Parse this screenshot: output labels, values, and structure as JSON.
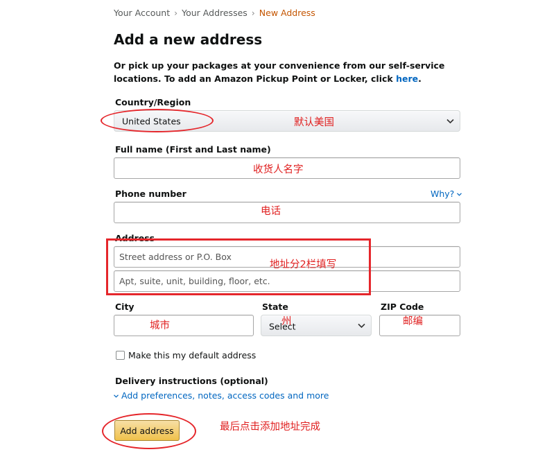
{
  "breadcrumb": {
    "items": [
      "Your Account",
      "Your Addresses"
    ],
    "current": "New Address",
    "separator": "›"
  },
  "page_title": "Add a new address",
  "intro": {
    "text": "Or pick up your packages at your convenience from our self-service locations. To add an Amazon Pickup Point or Locker, click",
    "link": "here",
    "end": "."
  },
  "country": {
    "label": "Country/Region",
    "value": "United States"
  },
  "full_name": {
    "label": "Full name (First and Last name)",
    "value": ""
  },
  "phone": {
    "label": "Phone number",
    "help": "Why?",
    "value": ""
  },
  "address": {
    "label": "Address",
    "line1_placeholder": "Street address or P.O. Box",
    "line2_placeholder": "Apt, suite, unit, building, floor, etc."
  },
  "city": {
    "label": "City",
    "value": ""
  },
  "state": {
    "label": "State",
    "value": "Select"
  },
  "zip": {
    "label": "ZIP Code",
    "value": ""
  },
  "default_checkbox": {
    "label": "Make this my default address",
    "checked": false
  },
  "delivery": {
    "label": "Delivery instructions (optional)",
    "link": "Add preferences, notes, access codes and more"
  },
  "submit": {
    "label": "Add address"
  },
  "annotations": {
    "country_note": "默认美国",
    "name_note": "收货人名字",
    "phone_note": "电话",
    "address_note": "地址分2栏填写",
    "city_note": "城市",
    "state_note": "州",
    "zip_note": "邮编",
    "submit_note": "最后点击添加地址完成"
  },
  "colors": {
    "link": "#0066c0",
    "breadcrumb_current": "#c45500",
    "annotation_red": "#e5262b",
    "button_top": "#f7dfa5",
    "button_bottom": "#f0c14b"
  }
}
